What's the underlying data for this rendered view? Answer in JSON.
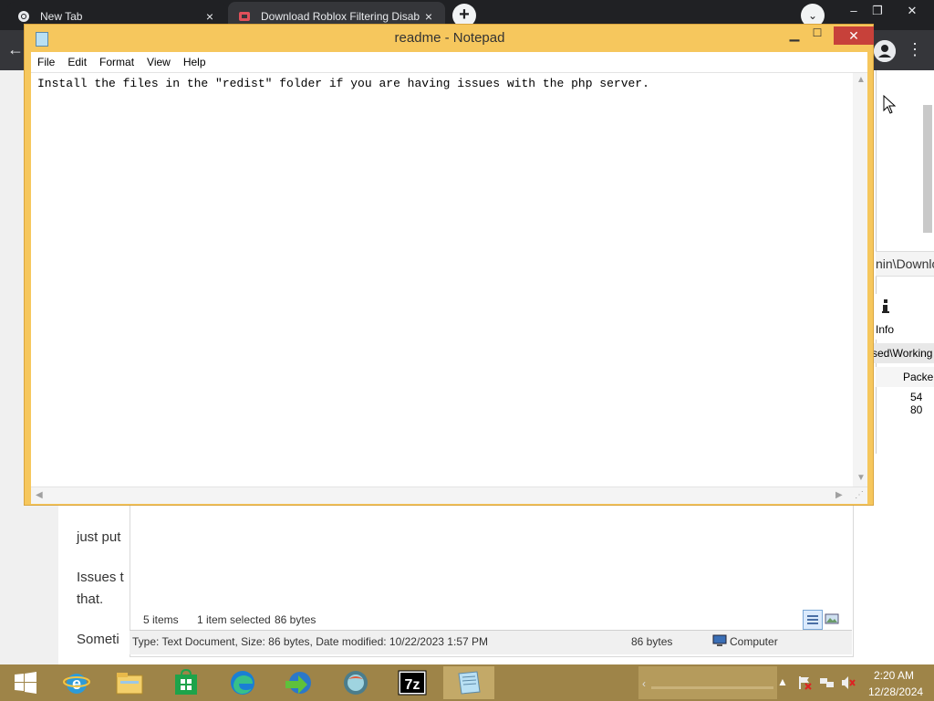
{
  "browser": {
    "tabs": [
      {
        "label": "New Tab",
        "close": "×"
      },
      {
        "label": "Download Roblox Filtering Disab",
        "close": "×"
      }
    ],
    "new_tab": "+",
    "tab_search": "⌄",
    "window_controls": {
      "minimize": "–",
      "restore": "❐",
      "close": "✕"
    },
    "back": "←",
    "menu": "⋮"
  },
  "webpage": {
    "lines": [
      "just put",
      "Issues t",
      "that.",
      "Someti"
    ]
  },
  "background_window": {
    "path": "nin\\Downlo",
    "info_label": "Info",
    "working": "sed\\Working",
    "packed_header": "Packe",
    "packed_value": "54 80"
  },
  "explorer": {
    "items_count": "5 items",
    "selected": "1 item selected",
    "selected_size": "86 bytes",
    "details": "Type: Text Document, Size: 86 bytes, Date modified: 10/22/2023 1:57 PM",
    "size": "86 bytes",
    "location": "Computer"
  },
  "notepad": {
    "title": "readme - Notepad",
    "menu": [
      "File",
      "Edit",
      "Format",
      "View",
      "Help"
    ],
    "content": "Install the files in the \"redist\" folder if you are having issues with the php server."
  },
  "taskbar": {
    "items": [
      "start",
      "internet-explorer",
      "file-explorer",
      "store",
      "edge",
      "internet-download-manager",
      "browser",
      "7zip",
      "notepad"
    ],
    "clock_time": "2:20 AM",
    "clock_date": "12/28/2024",
    "colors": {
      "taskbar": "#9e8448",
      "notepad_frame": "#f6c75d",
      "close": "#c7413a"
    }
  }
}
